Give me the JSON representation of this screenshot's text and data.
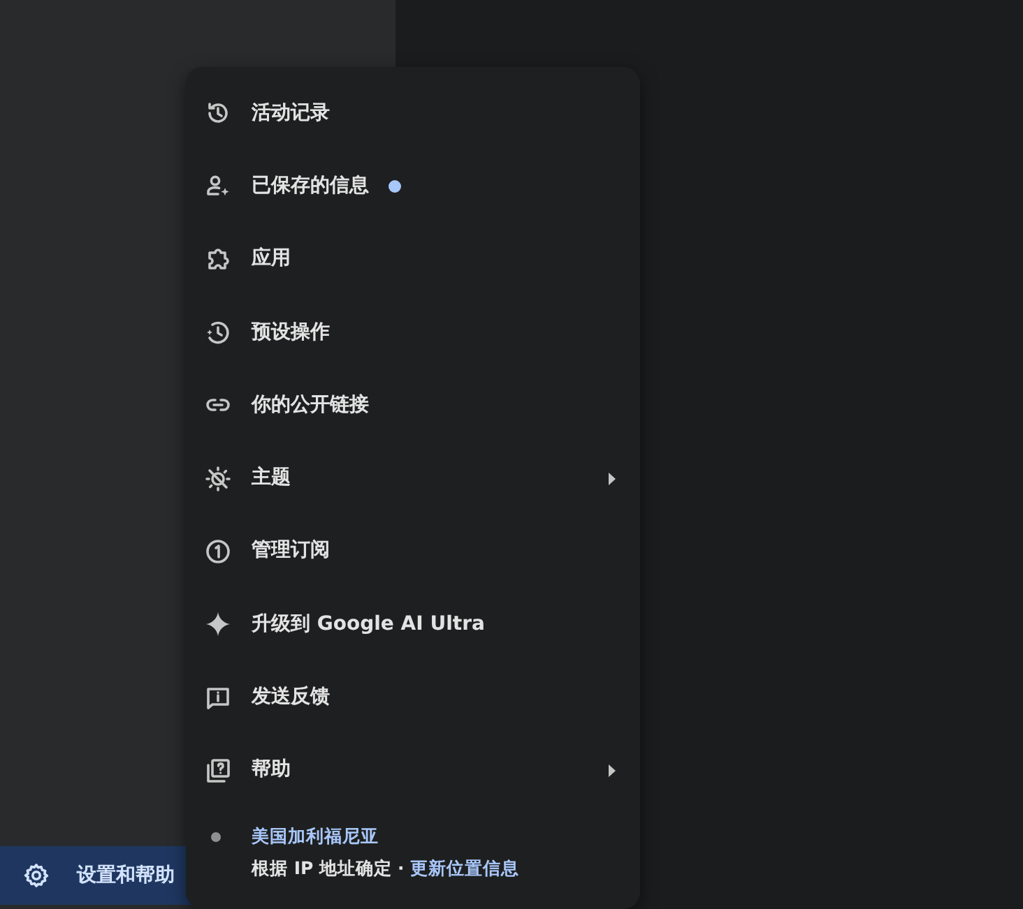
{
  "menu": {
    "items": [
      {
        "label": "活动记录",
        "badge_dot": false,
        "submenu": false
      },
      {
        "label": "已保存的信息",
        "badge_dot": true,
        "submenu": false
      },
      {
        "label": "应用",
        "badge_dot": false,
        "submenu": false
      },
      {
        "label": "预设操作",
        "badge_dot": false,
        "submenu": false
      },
      {
        "label": "你的公开链接",
        "badge_dot": false,
        "submenu": false
      },
      {
        "label": "主题",
        "badge_dot": false,
        "submenu": true
      },
      {
        "label": "管理订阅",
        "badge_dot": false,
        "submenu": false
      },
      {
        "label": "升级到 Google AI Ultra",
        "badge_dot": false,
        "submenu": false
      },
      {
        "label": "发送反馈",
        "badge_dot": false,
        "submenu": false
      },
      {
        "label": "帮助",
        "badge_dot": false,
        "submenu": true
      }
    ],
    "location": {
      "place": "美国加利福尼亚",
      "source": "根据 IP 地址确定",
      "separator": "·",
      "update_link": "更新位置信息"
    }
  },
  "sidebar": {
    "settings_button": "设置和帮助"
  }
}
